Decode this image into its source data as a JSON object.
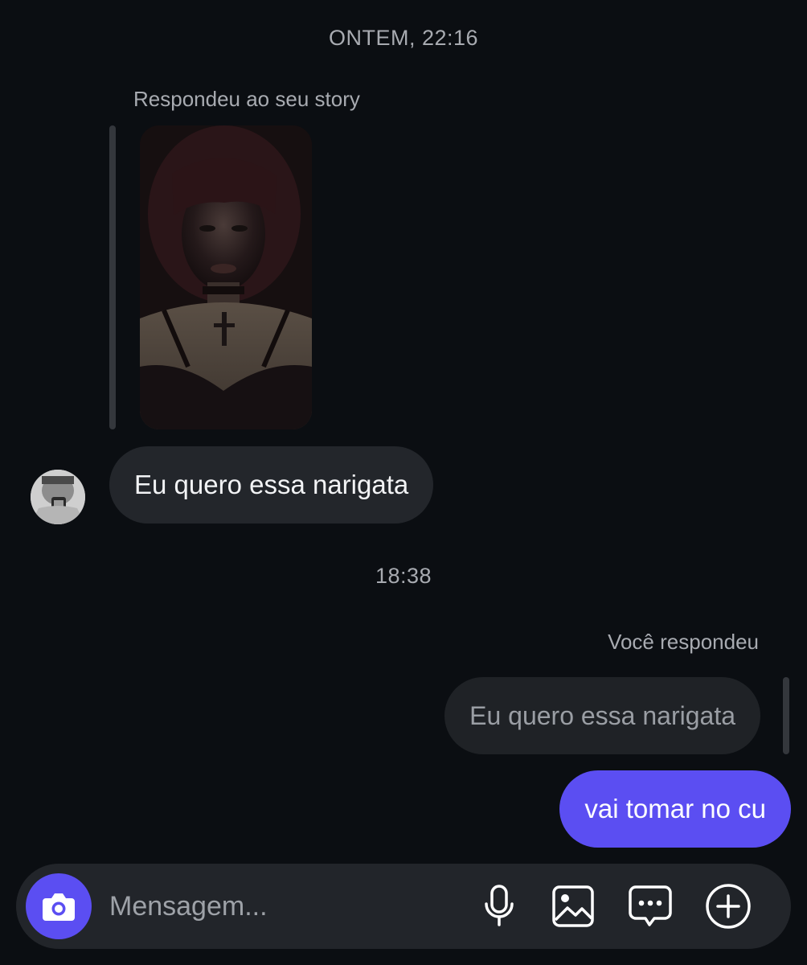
{
  "conversation": {
    "timestamp_top": "ONTEM, 22:16",
    "story_reply_caption": "Respondeu ao seu story",
    "incoming_message": "Eu quero essa narigata",
    "timestamp_mid": "18:38",
    "you_replied_label": "Você respondeu",
    "quoted_message": "Eu quero essa narigata",
    "outgoing_message": "vai tomar no cu"
  },
  "composer": {
    "placeholder": "Mensagem...",
    "value": ""
  },
  "icons": {
    "camera": "camera-icon",
    "mic": "microphone-icon",
    "gallery": "image-gallery-icon",
    "sticker": "chat-bubble-icon",
    "plus": "plus-circle-icon"
  },
  "colors": {
    "background": "#0b0e12",
    "incoming_bubble": "#23262b",
    "outgoing_bubble": "#5b4ef2",
    "accent": "#5b4ef2",
    "secondary_text": "#a8abb1"
  }
}
